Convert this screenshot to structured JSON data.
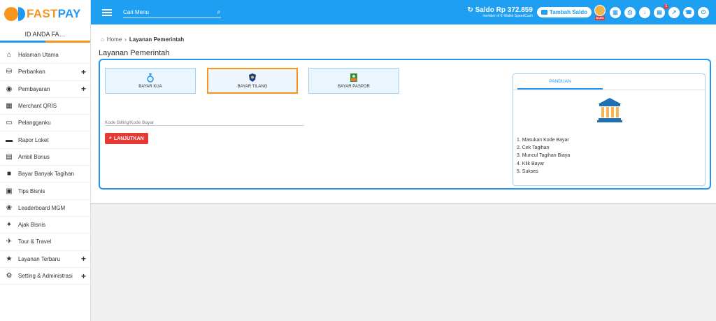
{
  "brand": {
    "fast": "FAST",
    "pay": "PAY"
  },
  "account": {
    "id_label": "ID ANDA FA…"
  },
  "menu": [
    {
      "label": "Halaman Utama",
      "icon": "home-icon",
      "glyph": "⌂",
      "expand": false
    },
    {
      "label": "Perbankan",
      "icon": "bank-icon",
      "glyph": "⛁",
      "expand": true
    },
    {
      "label": "Pembayaran",
      "icon": "payment-icon",
      "glyph": "◉",
      "expand": true
    },
    {
      "label": "Merchant QRIS",
      "icon": "qr-icon",
      "glyph": "▦",
      "expand": false
    },
    {
      "label": "Pelangganku",
      "icon": "customers-icon",
      "glyph": "▭",
      "expand": false
    },
    {
      "label": "Rapor Loket",
      "icon": "report-icon",
      "glyph": "▬",
      "expand": false
    },
    {
      "label": "Ambil Bonus",
      "icon": "bonus-icon",
      "glyph": "▤",
      "expand": false
    },
    {
      "label": "Bayar Banyak Tagihan",
      "icon": "bills-icon",
      "glyph": "■",
      "expand": false
    },
    {
      "label": "Tips Bisnis",
      "icon": "tips-icon",
      "glyph": "▣",
      "expand": false
    },
    {
      "label": "Leaderboard MGM",
      "icon": "trophy-icon",
      "glyph": "❀",
      "expand": false
    },
    {
      "label": "Ajak Bisnis",
      "icon": "handshake-icon",
      "glyph": "✦",
      "expand": false
    },
    {
      "label": "Tour & Travel",
      "icon": "plane-icon",
      "glyph": "✈",
      "expand": false
    },
    {
      "label": "Layanan Terbaru",
      "icon": "star-icon",
      "glyph": "★",
      "expand": true
    },
    {
      "label": "Setting & Administrasi",
      "icon": "settings-icon",
      "glyph": "⚙",
      "expand": true
    }
  ],
  "topbar": {
    "search_placeholder": "Cari Menu",
    "saldo": "↻ Saldo Rp 372.859",
    "saldo_sub": "member of E-Wallet SpeedCash",
    "topup_label": "Tambah Saldo",
    "medal_tag": "BARU",
    "notif_count": "1",
    "icons": [
      {
        "name": "stats-icon",
        "glyph": "▥"
      },
      {
        "name": "print-icon",
        "glyph": "⎙"
      },
      {
        "name": "download-icon",
        "glyph": "↓"
      },
      {
        "name": "cart-icon",
        "glyph": "▤",
        "notif": true
      },
      {
        "name": "chart-icon",
        "glyph": "↗"
      },
      {
        "name": "support-icon",
        "glyph": "☎"
      },
      {
        "name": "power-icon",
        "glyph": "⏻"
      }
    ],
    "colors": {
      "bar": "#1e9ff2"
    }
  },
  "breadcrumb": {
    "home": "Home",
    "separator": "›",
    "current": "Layanan Pemerintah"
  },
  "page_title": "Layanan Pemerintah",
  "services": [
    {
      "label": "BAYAR KUA",
      "icon": "ring-icon",
      "active": false
    },
    {
      "label": "BAYAR TILANG",
      "icon": "police-badge-icon",
      "active": true
    },
    {
      "label": "BAYAR PASPOR",
      "icon": "passport-icon",
      "active": false
    }
  ],
  "form": {
    "billing_placeholder": "Kode Billing/Kode Bayar",
    "submit_label": "LANJUTKAN"
  },
  "guide": {
    "tab_label": "PANDUAN",
    "steps": [
      "1. Masukan Kode Bayar",
      "2. Cek Tagihan",
      "3. Muncul Tagihan Biaya",
      "4. Klik Bayar",
      "5. Sukses"
    ]
  },
  "colors": {
    "accent_orange": "#f7941d",
    "accent_blue": "#2196f3",
    "danger_red": "#e53935"
  }
}
